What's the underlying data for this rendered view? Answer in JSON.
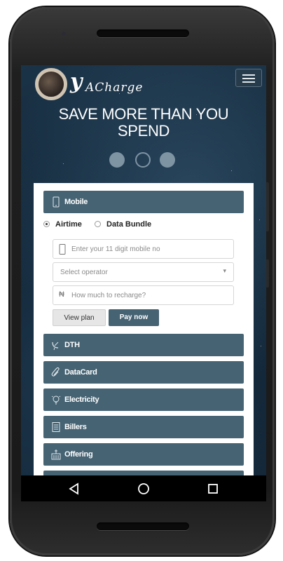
{
  "brand": {
    "logo_letter": "y",
    "logo_text": "ACharge"
  },
  "banner": {
    "headline_line1": "SAVE MORE THAN YOU",
    "headline_line2": "SPEND",
    "slides": 3,
    "active_slide": 1
  },
  "mobile_section": {
    "title": "Mobile",
    "radio_options": [
      {
        "label": "Airtime",
        "selected": true
      },
      {
        "label": "Data Bundle",
        "selected": false
      }
    ],
    "mobile_input_placeholder": "Enter your 11 digit mobile no",
    "operator_select_value": "Select operator",
    "amount_input_placeholder": "How much to recharge?",
    "currency_symbol": "₦",
    "view_plan_label": "View plan",
    "pay_now_label": "Pay now"
  },
  "sections": [
    {
      "label": "DTH",
      "icon": "satellite-dish-icon"
    },
    {
      "label": "DataCard",
      "icon": "paperclip-icon"
    },
    {
      "label": "Electricity",
      "icon": "lightbulb-icon"
    },
    {
      "label": "Billers",
      "icon": "document-icon"
    },
    {
      "label": "Offering",
      "icon": "church-icon"
    }
  ],
  "colors": {
    "accent": "#466373",
    "background": "#0f2233"
  }
}
